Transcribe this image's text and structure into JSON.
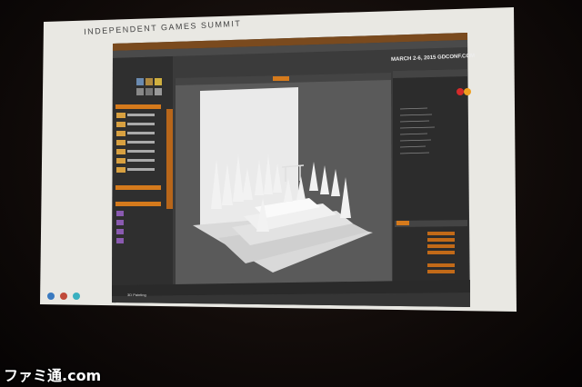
{
  "banner": {
    "title": "INDEPENDENT GAMES SUMMIT",
    "date": "MARCH 2-6, 2015",
    "site": "GDCONF.COM"
  },
  "app": {
    "mode_label": "3D Painting"
  },
  "watermark": "ファミ通.com",
  "colors": {
    "app_bg": "#3a3a3a",
    "accent_orange": "#d57a1c",
    "viewport_bg": "#5c5c5c",
    "model": "#e6e6e6",
    "screen_white": "#ecebe7"
  }
}
